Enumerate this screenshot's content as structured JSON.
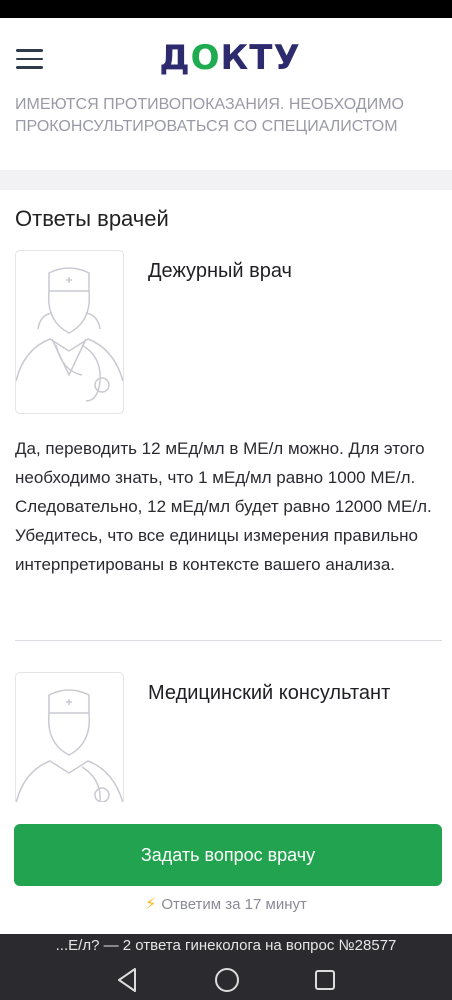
{
  "header": {
    "logo_text_start": "Д",
    "logo_accent": "О",
    "logo_text_end": "КТУ",
    "brand_color": "#2d2b6e",
    "accent_color": "#1fab4f"
  },
  "warning": {
    "text": "ИМЕЮТСЯ ПРОТИВОПОКАЗАНИЯ. НЕОБХОДИМО ПРОКОНСУЛЬТИРОВАТЬСЯ СО СПЕЦИАЛИСТОМ"
  },
  "answers": {
    "title": "Ответы врачей",
    "items": [
      {
        "doctor": "Дежурный врач",
        "text": "Да, переводить 12 мЕд/мл в МЕ/л можно. Для этого необходимо знать, что 1 мЕд/мл равно 1000 МЕ/л. Следовательно, 12 мЕд/мл будет равно 12000 МЕ/л. Убедитесь, что все единицы измерения правильно интерпретированы в контексте вашего анализа."
      },
      {
        "doctor": "Медицинский консультант"
      }
    ]
  },
  "cta": {
    "button_label": "Задать вопрос врачу",
    "eta_text": "Ответим за 17 минут",
    "button_color": "#22a34f"
  },
  "page_hint": "...Е/л? — 2 ответа гинеколога на вопрос №28577",
  "icons": {
    "menu": "hamburger-icon",
    "doctor": "doctor-avatar-icon",
    "bolt": "lightning-icon",
    "nav_back": "back-triangle-icon",
    "nav_home": "home-circle-icon",
    "nav_recent": "recent-apps-icon"
  }
}
